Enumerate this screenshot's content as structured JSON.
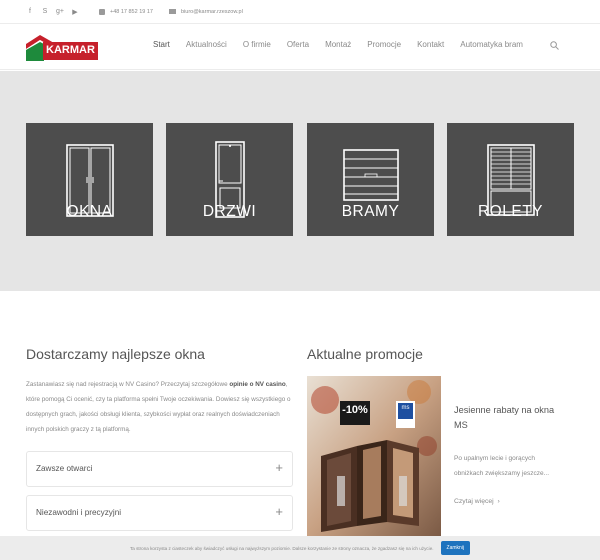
{
  "topbar": {
    "social": [
      "f",
      "S",
      "g+",
      "▶"
    ],
    "phone": "+48 17 852 19 17",
    "email": "biuro@karmar.rzeszow.pl"
  },
  "header": {
    "logo_text": "KARMAR",
    "nav": [
      "Start",
      "Aktualności",
      "O firmie",
      "Oferta",
      "Montaż",
      "Promocje",
      "Kontakt",
      "Automatyka bram"
    ]
  },
  "hero": {
    "tiles": [
      "OKNA",
      "DRZWI",
      "BRAMY",
      "ROLETY"
    ]
  },
  "left": {
    "heading": "Dostarczamy najlepsze okna",
    "para_1": "Zastanawiasz się nad rejestracją w NV Casino? Przeczytaj szczegółowe ",
    "para_bold": "opinie o NV casino",
    "para_2": ", które pomogą Ci ocenić, czy ta platforma spełni Twoje oczekiwania. Dowiesz się wszystkiego o dostępnych grach, jakości obsługi klienta, szybkości wypłat oraz realnych doświadczeniach innych polskich graczy z tą platformą.",
    "accordion": [
      "Zawsze otwarci",
      "Niezawodni i precyzyjni"
    ]
  },
  "right": {
    "heading": "Aktualne promocje",
    "badge": "-10%",
    "ms_logo": "ms",
    "promo_title": "Jesienne rabaty na okna MS",
    "promo_text": "Po upalnym lecie i gorących obniżkach zwiększamy jeszcze...",
    "more": "Czytaj więcej",
    "more_arrow": "›"
  },
  "cookie": {
    "text": "Ta strona korzysta z ciasteczek aby świadczyć usługi na najwyższym poziomie. Dalsze korzystanie ze strony oznacza, że zgadzasz się na ich użycie.",
    "button": "Zamknij"
  },
  "colors": {
    "tile": "#4d4d4d",
    "hero_bg": "#e5e5e5",
    "logo_red": "#c6202b",
    "logo_green": "#1e8a3c",
    "button": "#1e73be"
  }
}
